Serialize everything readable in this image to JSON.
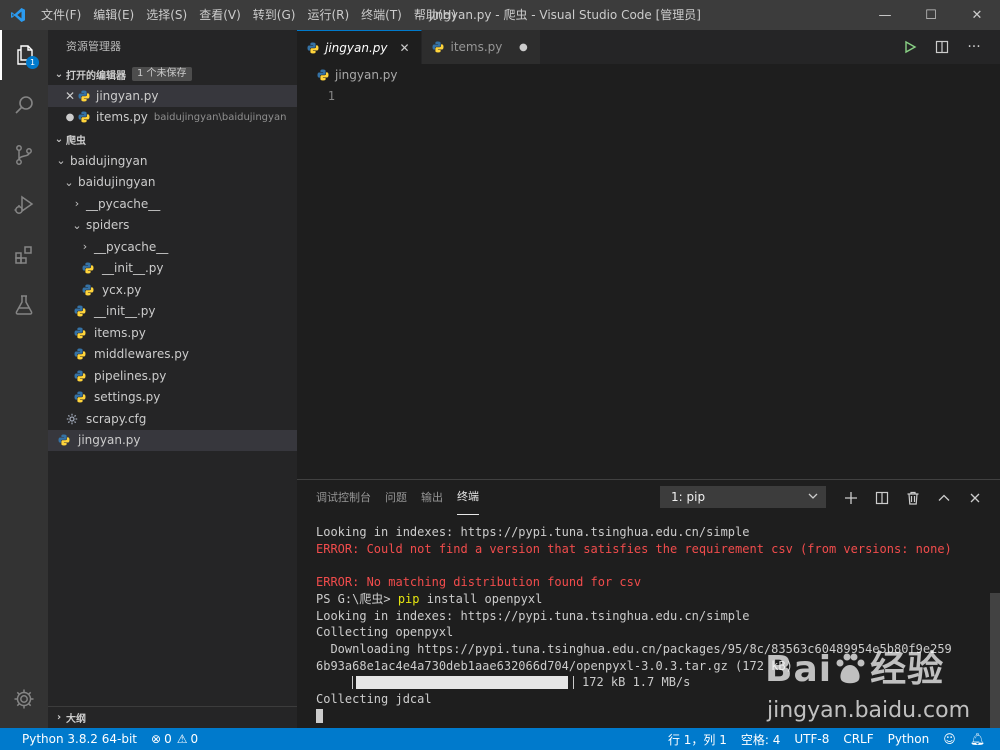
{
  "window": {
    "title": "jingyan.py - 爬虫 - Visual Studio Code [管理员]",
    "menu": [
      "文件(F)",
      "编辑(E)",
      "选择(S)",
      "查看(V)",
      "转到(G)",
      "运行(R)",
      "终端(T)",
      "帮助(H)"
    ],
    "controls": {
      "minimize": "—",
      "maximize": "☐",
      "close": "✕"
    }
  },
  "activity_bar": {
    "icons": [
      "explorer-icon",
      "search-icon",
      "source-control-icon",
      "run-debug-icon",
      "extensions-icon",
      "testing-icon"
    ],
    "explorer_badge": "1",
    "bottom_icon": "gear-icon"
  },
  "sidebar": {
    "title": "资源管理器",
    "open_editors": {
      "header": "打开的编辑器",
      "unsaved_badge": "1 个未保存",
      "items": [
        {
          "name": "jingyan.py",
          "desc": "",
          "state": "close"
        },
        {
          "name": "items.py",
          "desc": "baidujingyan\\baidujingyan",
          "state": "dirty"
        }
      ]
    },
    "folder": {
      "header": "爬虫",
      "tree": [
        {
          "label": "baidujingyan",
          "kind": "folder-open",
          "depth": 1
        },
        {
          "label": "baidujingyan",
          "kind": "folder-open",
          "depth": 2
        },
        {
          "label": "__pycache__",
          "kind": "folder-closed",
          "depth": 3
        },
        {
          "label": "spiders",
          "kind": "folder-open",
          "depth": 3
        },
        {
          "label": "__pycache__",
          "kind": "folder-closed",
          "depth": 4
        },
        {
          "label": "__init__.py",
          "kind": "py",
          "depth": 4
        },
        {
          "label": "ycx.py",
          "kind": "py",
          "depth": 4
        },
        {
          "label": "__init__.py",
          "kind": "py",
          "depth": 3
        },
        {
          "label": "items.py",
          "kind": "py",
          "depth": 3
        },
        {
          "label": "middlewares.py",
          "kind": "py",
          "depth": 3
        },
        {
          "label": "pipelines.py",
          "kind": "py",
          "depth": 3
        },
        {
          "label": "settings.py",
          "kind": "py",
          "depth": 3
        },
        {
          "label": "scrapy.cfg",
          "kind": "cfg",
          "depth": 2
        },
        {
          "label": "jingyan.py",
          "kind": "py",
          "depth": 1,
          "selected": true
        }
      ]
    },
    "outline_header": "大纲"
  },
  "editor": {
    "tabs": [
      {
        "label": "jingyan.py",
        "active": true,
        "state": "close"
      },
      {
        "label": "items.py",
        "active": false,
        "state": "dirty"
      }
    ],
    "breadcrumb": "jingyan.py",
    "line_number": "1",
    "actions": [
      "run-icon",
      "split-editor-icon",
      "more-icon"
    ]
  },
  "panel": {
    "tabs": [
      {
        "label": "调试控制台",
        "active": false
      },
      {
        "label": "问题",
        "active": false
      },
      {
        "label": "输出",
        "active": false
      },
      {
        "label": "终端",
        "active": true
      }
    ],
    "terminal_select": "1: pip",
    "terminal_lines": [
      {
        "type": "normal",
        "text": "Looking in indexes: https://pypi.tuna.tsinghua.edu.cn/simple"
      },
      {
        "type": "error",
        "text": "ERROR: Could not find a version that satisfies the requirement csv (from versions: none)"
      },
      {
        "type": "blank",
        "text": ""
      },
      {
        "type": "error",
        "text": "ERROR: No matching distribution found for csv"
      },
      {
        "type": "cmd",
        "prompt": "PS G:\\爬虫> ",
        "cmd": "pip",
        "args": " install openpyxl"
      },
      {
        "type": "normal",
        "text": "Looking in indexes: https://pypi.tuna.tsinghua.edu.cn/simple"
      },
      {
        "type": "normal",
        "text": "Collecting openpyxl"
      },
      {
        "type": "normal",
        "text": "  Downloading https://pypi.tuna.tsinghua.edu.cn/packages/95/8c/83563c60489954e5b80f9e259"
      },
      {
        "type": "normal",
        "text": "6b93a68e1ac4e4a730deb1aae632066d704/openpyxl-3.0.3.tar.gz (172 kB)"
      },
      {
        "type": "progress",
        "fraction": 0.99,
        "text": "172 kB 1.7 MB/s"
      },
      {
        "type": "normal",
        "text": "Collecting jdcal"
      }
    ]
  },
  "statusbar": {
    "python": "Python 3.8.2 64-bit",
    "errors": "0",
    "warnings": "0",
    "position": "行 1，列 1",
    "spaces": "空格: 4",
    "encoding": "UTF-8",
    "eol": "CRLF",
    "language": "Python"
  },
  "watermark": {
    "brand": "Bai du 经验",
    "url": "jingyan.baidu.com"
  },
  "colors": {
    "accent": "#007acc",
    "error": "#f14c4c",
    "command": "#e5e510",
    "python_blue": "#3572a5",
    "python_yellow": "#ffd43b"
  }
}
